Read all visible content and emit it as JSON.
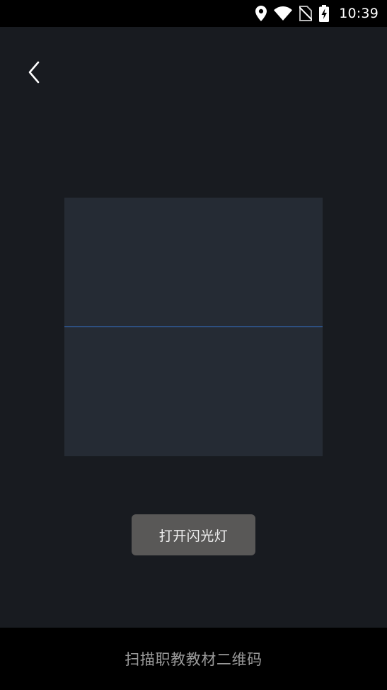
{
  "status_bar": {
    "time": "10:39",
    "icons": [
      "location-icon",
      "wifi-icon",
      "no-sim-icon",
      "battery-charging-icon"
    ]
  },
  "toolbar": {
    "back_icon": "chevron-left-icon"
  },
  "scanner": {
    "flash_button_label": "打开闪光灯"
  },
  "footer": {
    "caption": "扫描职教教材二维码"
  },
  "colors": {
    "camera_background": "#181b20",
    "scan_frame": "#252b34",
    "scan_line": "#2d4f80",
    "flash_button": "#595857",
    "caption_text": "#9a9a9a"
  }
}
